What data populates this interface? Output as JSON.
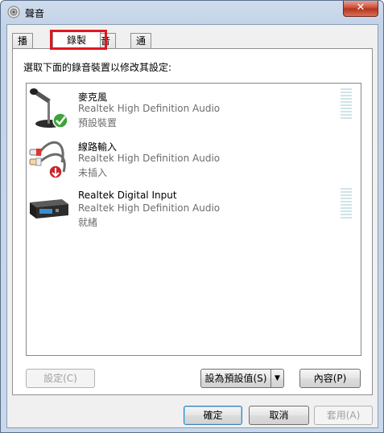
{
  "window": {
    "title": "聲音",
    "close_label": "✕"
  },
  "tabs": [
    {
      "label": "播放",
      "active": false
    },
    {
      "label": "錄製",
      "active": true
    },
    {
      "label": "音效",
      "active": false
    },
    {
      "label": "通訊",
      "active": false
    }
  ],
  "recording": {
    "instruction": "選取下面的錄音裝置以修改其設定:",
    "devices": [
      {
        "name": "麥克風",
        "driver": "Realtek High Definition Audio",
        "status": "預設裝置",
        "icon": "microphone-icon",
        "badge": "default-check-icon"
      },
      {
        "name": "線路輸入",
        "driver": "Realtek High Definition Audio",
        "status": "未插入",
        "icon": "line-in-cable-icon",
        "badge": "unplugged-arrow-icon"
      },
      {
        "name": "Realtek Digital Input",
        "driver": "Realtek High Definition Audio",
        "status": "就緒",
        "icon": "digital-input-device-icon"
      }
    ],
    "configure_label": "設定(C)",
    "set_default_label": "設為預設值(S)",
    "properties_label": "內容(P)"
  },
  "footer": {
    "ok_label": "確定",
    "cancel_label": "取消",
    "apply_label": "套用(A)"
  },
  "colors": {
    "tab_highlight": "#e0161f",
    "check_green": "#3ea33a",
    "unplugged_red": "#c8272b",
    "level_meter": "#cfe3e8"
  }
}
